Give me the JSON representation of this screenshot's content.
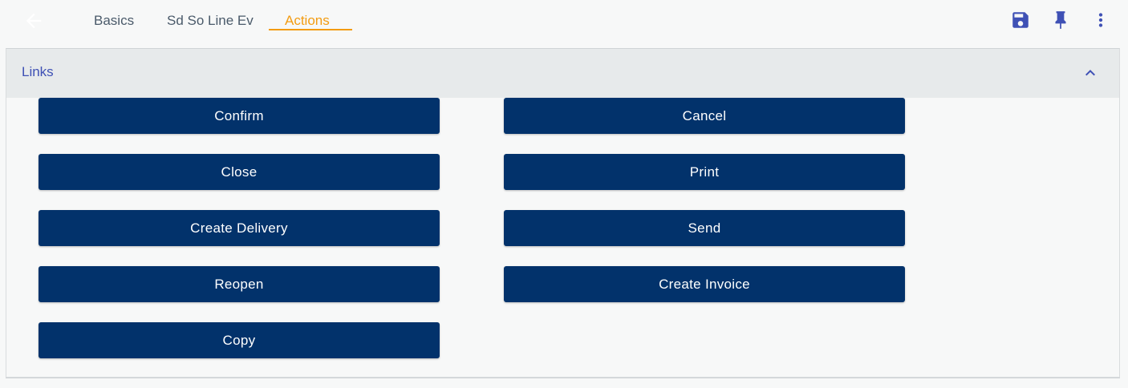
{
  "tabs": [
    {
      "label": "Basics"
    },
    {
      "label": "Sd So Line Ev"
    },
    {
      "label": "Actions"
    }
  ],
  "active_tab": "Actions",
  "colors": {
    "accent": "#f39c12",
    "primary_button": "#02326b",
    "icon": "#3f51b5",
    "header_text": "#3f51b5"
  },
  "icons": {
    "back": "arrow-back-icon",
    "save": "save-icon",
    "pin": "pin-icon",
    "more": "more-vertical-icon",
    "collapse": "chevron-up-icon"
  },
  "links_section": {
    "title": "Links",
    "buttons": [
      {
        "label": "Confirm"
      },
      {
        "label": "Cancel"
      },
      {
        "label": "Close"
      },
      {
        "label": "Print"
      },
      {
        "label": "Create Delivery"
      },
      {
        "label": "Send"
      },
      {
        "label": "Reopen"
      },
      {
        "label": "Create Invoice"
      },
      {
        "label": "Copy"
      }
    ]
  }
}
